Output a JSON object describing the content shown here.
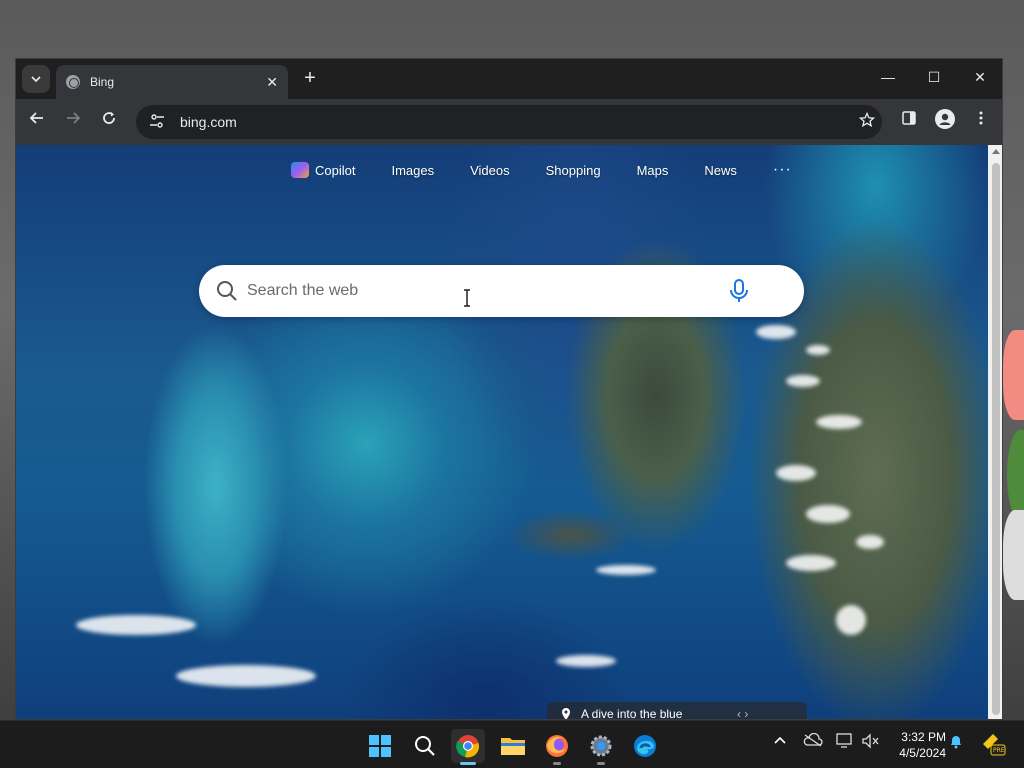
{
  "browser": {
    "tab_title": "Bing",
    "new_tab_symbol": "+",
    "tab_close_symbol": "✕",
    "address": "bing.com",
    "window_controls": {
      "minimize": "—",
      "maximize": "☐",
      "close": "✕"
    }
  },
  "bing": {
    "nav": {
      "copilot": "Copilot",
      "images": "Images",
      "videos": "Videos",
      "shopping": "Shopping",
      "maps": "Maps",
      "news": "News",
      "more": "···"
    },
    "search_placeholder": "Search the web",
    "caption": "A dive into the blue",
    "caption_arrows": "‹   ›"
  },
  "taskbar": {
    "time": "3:32 PM",
    "date": "4/5/2024",
    "apps": [
      "start-icon",
      "search-icon",
      "chrome-icon",
      "file-explorer-icon",
      "firefox-icon",
      "settings-icon",
      "edge-icon"
    ],
    "tray_badge": "PRE"
  },
  "colors": {
    "chrome_dark": "#202124",
    "toolbar": "#35363a",
    "windows_blue": "#0078d4",
    "taskbar": "#1c1c1c",
    "bing_mic": "#1a73e8"
  }
}
